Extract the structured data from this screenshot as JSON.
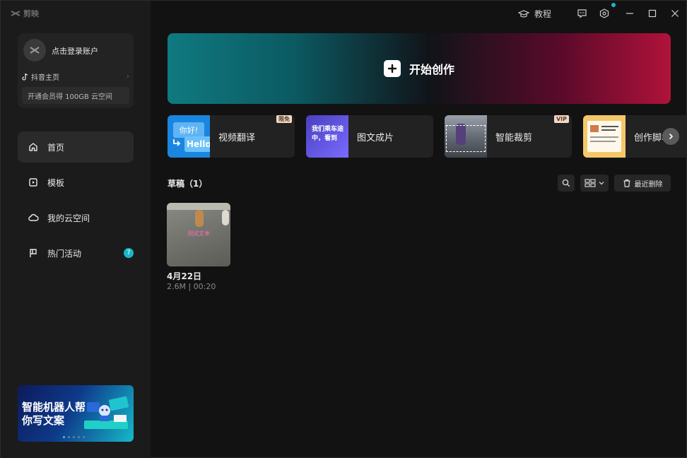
{
  "app": {
    "name": "剪映"
  },
  "account": {
    "login_text": "点击登录账户",
    "douyin_label": "抖音主页",
    "member_text": "开通会员得 100GB 云空间"
  },
  "nav": {
    "items": [
      {
        "label": "首页",
        "icon": "home-icon",
        "active": true
      },
      {
        "label": "模板",
        "icon": "template-icon"
      },
      {
        "label": "我的云空间",
        "icon": "cloud-icon"
      },
      {
        "label": "热门活动",
        "icon": "flag-icon",
        "badge": "7"
      }
    ]
  },
  "banner": {
    "title": "智能机器人帮你写文案"
  },
  "titlebar": {
    "tutorial_label": "教程"
  },
  "hero": {
    "label": "开始创作"
  },
  "tools": [
    {
      "label": "视频翻译",
      "tag": "限免",
      "thumb_text_top": "你好!",
      "thumb_text_bottom": "Hello"
    },
    {
      "label": "图文成片",
      "thumb_text": "我们乘车途中，看到"
    },
    {
      "label": "智能裁剪",
      "tag": "VIP"
    },
    {
      "label": "创作脚本"
    }
  ],
  "drafts": {
    "title": "草稿（1）",
    "recent_delete_label": "最近删除",
    "items": [
      {
        "name": "4月22日",
        "meta": "2.6M | 00:20",
        "caption": "测试文本"
      }
    ]
  },
  "colors": {
    "accent": "#19b7c6",
    "hero_left": "#0f7a80",
    "hero_right": "#b0123a"
  }
}
